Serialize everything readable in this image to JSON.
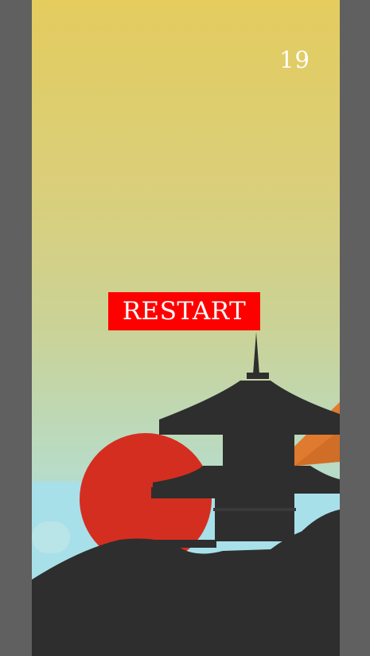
{
  "game": {
    "score": "19",
    "restart_label": "RESTART"
  },
  "colors": {
    "frame": "#606060",
    "sky_top": "#e4cc5e",
    "sky_bottom": "#a3dde4",
    "sun": "#d42e20",
    "silhouette": "#2e2e2e",
    "tree": "#e07a2e",
    "restart_button": "#ff0000",
    "text": "#ffffff"
  }
}
